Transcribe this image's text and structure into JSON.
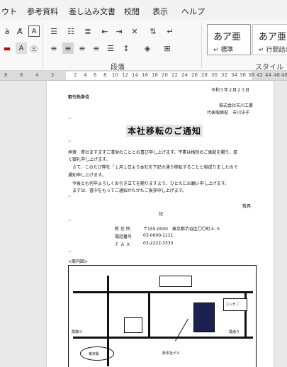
{
  "tabs": [
    "ウト",
    "参考資料",
    "差し込み文書",
    "校閲",
    "表示",
    "ヘルプ"
  ],
  "ribbon": {
    "paragraph_label": "段落",
    "style_label": "スタイル",
    "styles": [
      {
        "sample": "あア亜",
        "name": "↵ 標準"
      },
      {
        "sample": "あア亜",
        "name": "↵ 行間詰め"
      }
    ]
  },
  "ruler": {
    "left_numbers": [
      "8",
      "6",
      "4",
      "2"
    ],
    "numbers": [
      "2",
      "4",
      "6",
      "8",
      "10",
      "12",
      "14",
      "16",
      "18",
      "20",
      "22",
      "24",
      "26",
      "28",
      "30",
      "32",
      "34",
      "36",
      "38"
    ],
    "right_numbers": [
      "42",
      "44",
      "46",
      "48"
    ]
  },
  "doc": {
    "date": "令和３年２月２３日",
    "recipient": "取引先各位",
    "company": "株式会社市川工業",
    "rep": "代表取締役　市川洋子",
    "title": "本社移転のご通知",
    "body": [
      "拝啓　貴社ますますご清栄のこととお喜び申し上げます。平素は格別のご高配を賜り、厚",
      "く御礼申し上げます。",
      "　さて、このたび弊社「１月１日より本社を下記の通り移転することと相成りましたので",
      "通知申し上げます。",
      "　今後とも何卒よろしくお引き立てを賜りますよう、ひとえにお願い申し上げます。",
      "　まずは、書中をもってご通知かたがたご挨拶申し上げます。"
    ],
    "closing": "敬具",
    "ki": "記",
    "address_rows": [
      {
        "label": "新 住 所",
        "value": "〒155-0000　東京都渋谷区〇〇町４-６"
      },
      {
        "label": "電話番号",
        "value": "03-0000-1111"
      },
      {
        "label": "Ｆ Ａ Ｘ",
        "value": "03-2222-3333"
      }
    ],
    "map_caption": "<案内図>",
    "map": {
      "convenience": "コンビニ",
      "left_road": "霞霧川",
      "right_road": "霞通り",
      "station": "東京駅",
      "building": "新本社ビル"
    }
  },
  "colors": {
    "building": "#1b2252",
    "ribbon_bg": "#f8f8f8",
    "page": "#ffffff"
  }
}
